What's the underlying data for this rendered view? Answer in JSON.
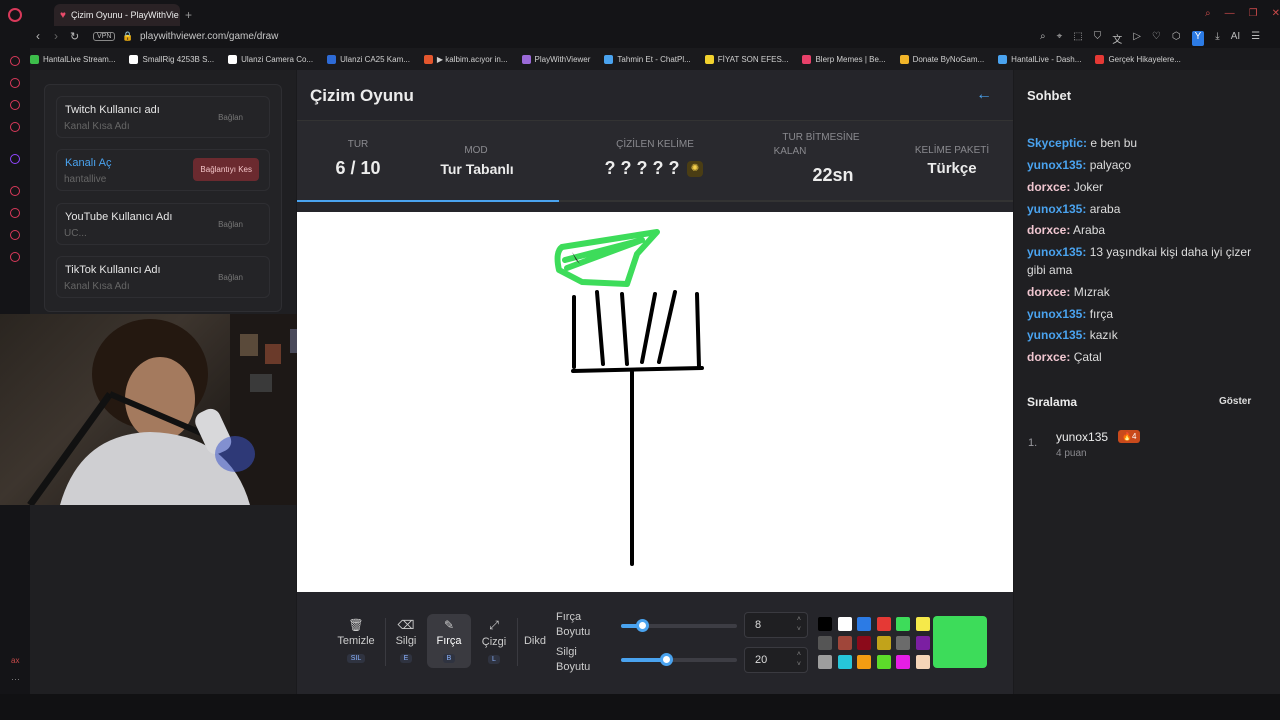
{
  "browser": {
    "tab_title": "Çizim Oyunu - PlayWithVie",
    "url": "playwithviewer.com/game/draw",
    "vpn_label": "VPN",
    "bookmarks": [
      {
        "label": "HantalLive Stream...",
        "color": "#3dbd4b"
      },
      {
        "label": "SmallRig 4253B S...",
        "color": "#ffffff"
      },
      {
        "label": "Ulanzi Camera Co...",
        "color": "#ffffff"
      },
      {
        "label": "Ulanzi CA25 Kam...",
        "color": "#2e6bd6"
      },
      {
        "label": "▶ kalbim.acıyor in...",
        "color": "#e4572e"
      },
      {
        "label": "PlayWithViewer",
        "color": "#9b6ad8"
      },
      {
        "label": "Tahmin Et - ChatPl...",
        "color": "#4aa3ef"
      },
      {
        "label": "FİYAT SON EFES...",
        "color": "#f2d22e"
      },
      {
        "label": "Blerp Memes | Be...",
        "color": "#e8416a"
      },
      {
        "label": "Donate ByNoGam...",
        "color": "#f0b429"
      },
      {
        "label": "HantalLive - Dash...",
        "color": "#4aa3ef"
      },
      {
        "label": "Gerçek Hikayelere...",
        "color": "#e53935"
      }
    ]
  },
  "accounts": [
    {
      "title": "Twitch Kullanıcı adı",
      "sub": "Kanal Kısa Adı",
      "btn": "Bağlan"
    },
    {
      "title": "Kanalı Aç",
      "sub": "hantallive",
      "btn": "Bağlantıyı Kes"
    },
    {
      "title": "YouTube Kullanıcı Adı",
      "sub": "UC...",
      "btn": "Bağlan"
    },
    {
      "title": "TikTok Kullanıcı Adı",
      "sub": "Kanal Kısa Adı",
      "btn": "Bağlan"
    }
  ],
  "game": {
    "title": "Çizim Oyunu",
    "stats": {
      "round_label": "TUR",
      "round_value": "6 / 10",
      "mode_label": "MOD",
      "mode_value": "Tur Tabanlı",
      "word_label": "ÇİZİLEN KELİME",
      "word_value": "? ? ? ? ?",
      "time_label_1": "TUR BİTMESİNE",
      "time_label_2": "KALAN",
      "time_value": "22sn",
      "pack_label": "KELİME PAKETİ",
      "pack_value": "Türkçe"
    },
    "round_progress": 0.6
  },
  "tools": {
    "clear": {
      "label": "Temizle",
      "key": "SIL"
    },
    "eraser": {
      "label": "Silgi",
      "key": "E"
    },
    "brush": {
      "label": "Fırça",
      "key": "B"
    },
    "line": {
      "label": "Çizgi",
      "key": "L"
    },
    "rect": {
      "label": "Dikd"
    },
    "brush_size_label": [
      "Fırça",
      "Boyutu"
    ],
    "eraser_size_label": [
      "Silgi",
      "Boyutu"
    ],
    "brush_size": "8",
    "eraser_size": "20",
    "brush_size_fraction": 0.18,
    "eraser_size_fraction": 0.39,
    "palette": [
      "#000000",
      "#ffffff",
      "#2c7be5",
      "#e53935",
      "#3ddc5a",
      "#f6e94a",
      "#555555",
      "#a0463a",
      "#8b0a1a",
      "#c2a31a",
      "#6b6b6b",
      "#7b1fa2",
      "#9e9e9e",
      "#26c6da",
      "#f39c12",
      "#5cdc2a",
      "#e61ee6",
      "#f5d5b8"
    ],
    "current_color": "#3ddc5a"
  },
  "chat": {
    "title": "Sohbet",
    "messages": [
      {
        "user": "Skyceptic:",
        "text": " e ben bu",
        "color": "#4aa3ef"
      },
      {
        "user": "yunox135:",
        "text": " palyaço",
        "color": "#4aa3ef"
      },
      {
        "user": "dorxce:",
        "text": " Joker",
        "color": "#f0c6d0"
      },
      {
        "user": "yunox135:",
        "text": " araba",
        "color": "#4aa3ef"
      },
      {
        "user": "dorxce:",
        "text": " Araba",
        "color": "#f0c6d0"
      },
      {
        "user": "yunox135:",
        "text": " 13 yaşındkai kişi daha iyi çizer gibi ama",
        "color": "#4aa3ef"
      },
      {
        "user": "dorxce:",
        "text": " Mızrak",
        "color": "#f0c6d0"
      },
      {
        "user": "yunox135:",
        "text": " fırça",
        "color": "#4aa3ef"
      },
      {
        "user": "yunox135:",
        "text": " kazık",
        "color": "#4aa3ef"
      },
      {
        "user": "dorxce:",
        "text": " Çatal",
        "color": "#f0c6d0"
      }
    ]
  },
  "ranking": {
    "title": "Sıralama",
    "show": "Göster",
    "entries": [
      {
        "rank": "1.",
        "name": "yunox135",
        "badge": "🔥4",
        "points": "4 puan"
      }
    ]
  },
  "sidebar_label": "ax"
}
